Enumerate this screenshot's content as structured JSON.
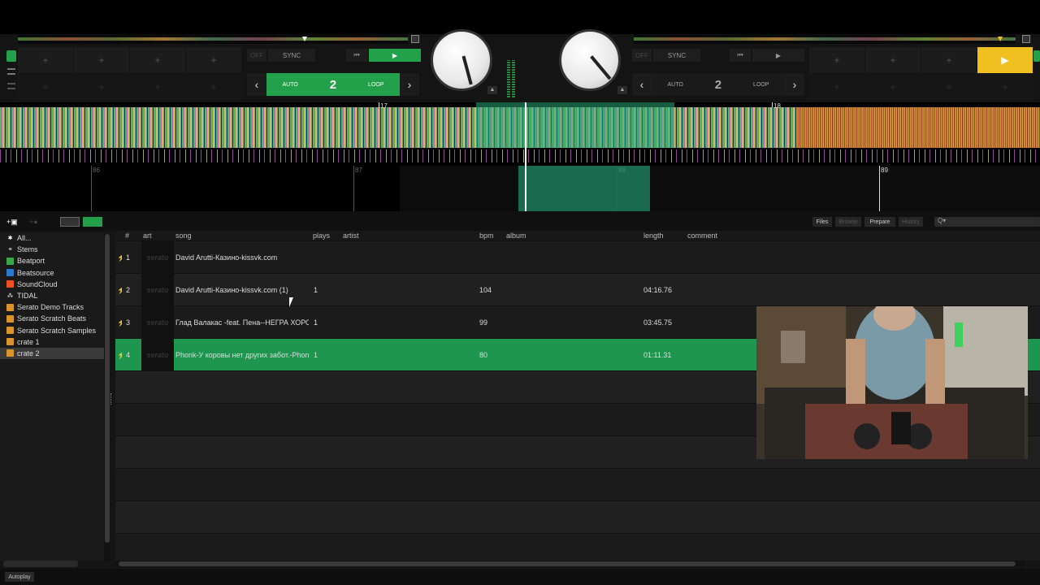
{
  "deck_left": {
    "sync_label": "SYNC",
    "off_label": "OFF",
    "loop_auto": "AUTO",
    "loop_value": "2",
    "loop_label": "LOOP",
    "pad_symbol": "+"
  },
  "deck_right": {
    "sync_label": "SYNC",
    "off_label": "OFF",
    "loop_auto": "AUTO",
    "loop_value": "2",
    "loop_label": "LOOP",
    "pad_symbol": "+",
    "play_symbol": "▶"
  },
  "waveform": {
    "beat_markers": [
      "17",
      "18"
    ],
    "bar_labels": [
      "86",
      "87",
      "88",
      "89"
    ]
  },
  "toolbar": {
    "files": "Files",
    "browse": "Browse",
    "prepare": "Prepare",
    "history": "History",
    "search_placeholder": "Q▾"
  },
  "sidebar": {
    "items": [
      {
        "label": "All...",
        "icon": "star-icon",
        "color": "#ffffff"
      },
      {
        "label": "Stems",
        "icon": "stems-icon",
        "color": "#ffffff"
      },
      {
        "label": "Beatport",
        "icon": "beatport-icon",
        "color": "#3aa84a"
      },
      {
        "label": "Beatsource",
        "icon": "beatsource-icon",
        "color": "#2a7ad0"
      },
      {
        "label": "SoundCloud",
        "icon": "soundcloud-icon",
        "color": "#f05020"
      },
      {
        "label": "TIDAL",
        "icon": "tidal-icon",
        "color": "#ffffff"
      },
      {
        "label": "Serato Demo Tracks",
        "icon": "crate-icon",
        "color": "#d9942a"
      },
      {
        "label": "Serato Scratch Beats",
        "icon": "crate-icon",
        "color": "#d9942a"
      },
      {
        "label": "Serato Scratch Samples",
        "icon": "crate-icon",
        "color": "#d9942a"
      },
      {
        "label": "crate 1",
        "icon": "crate-icon",
        "color": "#d9942a"
      },
      {
        "label": "crate 2",
        "icon": "crate-icon",
        "color": "#d9942a"
      }
    ]
  },
  "table": {
    "headers": {
      "num": "#",
      "art": "art",
      "song": "song",
      "plays": "plays",
      "artist": "artist",
      "bpm": "bpm",
      "album": "album",
      "length": "length",
      "comment": "comment"
    },
    "art_placeholder": "serato",
    "rows": [
      {
        "num": "1",
        "song": "David Arutti-Казино-kissvk.com",
        "plays": "",
        "bpm": "",
        "length": ""
      },
      {
        "num": "2",
        "song": "David Arutti-Казино-kissvk.com (1)",
        "plays": "1",
        "bpm": "104",
        "length": "04:16.76"
      },
      {
        "num": "3",
        "song": "Глад Валакас -feat. Пена--НЕГРА ХОРОШ",
        "plays": "1",
        "bpm": "99",
        "length": "03:45.75"
      },
      {
        "num": "4",
        "song": "Phonk-У коровы нет других забот.-Phonk",
        "plays": "1",
        "bpm": "80",
        "length": "01:11.31"
      }
    ]
  },
  "bottom": {
    "autoplay": "Autoplay"
  },
  "colors": {
    "accent_green": "#22a04a",
    "selected_row": "#1f9650",
    "cue_yellow": "#f0c020"
  }
}
